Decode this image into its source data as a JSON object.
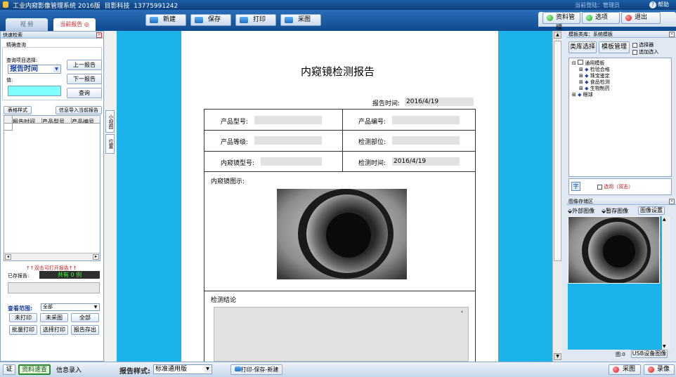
{
  "app": {
    "title": "工业内窥影像管理系统 2016版",
    "company": "目影科技",
    "phone": "13775991242",
    "user_label": "当前登陆：管理员",
    "help_label": "帮助"
  },
  "tabs": [
    {
      "label": "视 频"
    },
    {
      "label": "当前报告"
    }
  ],
  "toolbar": {
    "new_label": "新建",
    "save_label": "保存",
    "print_label": "打印",
    "capture_label": "采图"
  },
  "right_top_buttons": {
    "data_manage_label": "资料管理",
    "options_label": "选项",
    "exit_label": "退出"
  },
  "left_panel": {
    "title": "快速检索",
    "section_label": "精确查询",
    "query_item_label": "查询项目选择:",
    "query_item_value": "报告时间",
    "value_label": "值:",
    "prev_report_label": "上一报告",
    "next_report_label": "下一报告",
    "query_label": "查询",
    "tab_style_label": "表格样式",
    "info_import_label": "信息导入当前报告",
    "columns": [
      "报告时间",
      "产品型号",
      "产品编号"
    ],
    "double_click_hint": "↑↑双击可打开报告↑↑",
    "saved_label": "已存报告:",
    "saved_value": "共有 0 例",
    "view_range_label": "查看范围:",
    "view_range_value": "全部",
    "not_printed_label": "未打印",
    "not_captured_label": "未采图",
    "all_label": "全部",
    "batch_print_label": "批量打印",
    "select_print_label": "选择打印",
    "export_label": "报告存出"
  },
  "side_tabs": {
    "small_view": "小视图",
    "position": "位置"
  },
  "report": {
    "title": "内窥镜检测报告",
    "report_time_label": "报告时间:",
    "report_time_value": "2016/4/19",
    "product_model_label": "产品型号:",
    "product_number_label": "产品编号:",
    "product_grade_label": "产品等级:",
    "inspect_part_label": "检测部位:",
    "endoscope_model_label": "内窥镜型号:",
    "inspect_time_label": "检测时间:",
    "inspect_time_value": "2016/4/19",
    "image_label": "内窥镜图示:",
    "conclusion_label": "检测结论"
  },
  "template_panel": {
    "title": "模板类库：系统模板",
    "lib_select_label": "类库选择",
    "template_manage_label": "模板管理",
    "selector_label": "选择器",
    "append_label": "追加选入",
    "tree": [
      "通用模板",
      "检验合格",
      "珠宝鉴定",
      "食品检测",
      "生物制药",
      "眼球"
    ],
    "font_button": "字",
    "select_double_label": "选用（双击）"
  },
  "image_panel": {
    "title": "图像存储区",
    "external_label": "外部图像",
    "temp_save_label": "暂存图像",
    "settings_label": "图像设置",
    "count_label": "图:0",
    "usb_label": "USB设备图像"
  },
  "bottom_bar": {
    "cert_label": "证",
    "quick_data_label": "资料速查",
    "info_entry_label": "信息录入",
    "report_style_label": "报告样式:",
    "report_style_value": "标准通用版",
    "print_save_new_label": "打印-保存-新建",
    "capture_label": "采图",
    "record_label": "录像"
  },
  "colors": {
    "accent": "#1cb3ea",
    "titlebar": "#0c3f7c",
    "saved_value": "#33ff33"
  }
}
